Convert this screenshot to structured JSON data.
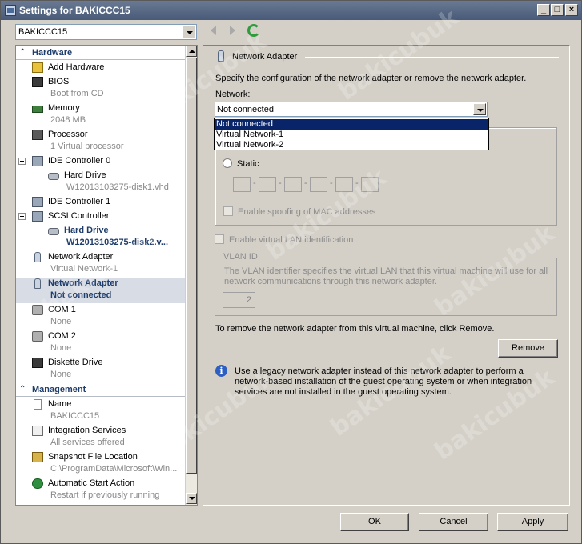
{
  "window": {
    "title": "Settings for BAKICCC15",
    "min_btn": "_",
    "max_btn": "□",
    "close_btn": "×"
  },
  "machine_selector": {
    "value": "BAKICCC15"
  },
  "tree": {
    "hardware_header": "Hardware",
    "management_header": "Management",
    "items": [
      {
        "label": "Add Hardware",
        "sub": "",
        "icon": "add-hardware-icon"
      },
      {
        "label": "BIOS",
        "sub": "Boot from CD",
        "icon": "bios-icon"
      },
      {
        "label": "Memory",
        "sub": "2048 MB",
        "icon": "memory-icon"
      },
      {
        "label": "Processor",
        "sub": "1 Virtual processor",
        "icon": "processor-icon"
      },
      {
        "label": "IDE Controller 0",
        "sub": "",
        "icon": "ide-controller-icon"
      },
      {
        "label": "Hard Drive",
        "sub": "W12013103275-disk1.vhd",
        "icon": "hard-drive-icon"
      },
      {
        "label": "IDE Controller 1",
        "sub": "",
        "icon": "ide-controller-icon"
      },
      {
        "label": "SCSI Controller",
        "sub": "",
        "icon": "scsi-controller-icon"
      },
      {
        "label": "Hard Drive",
        "sub": "W12013103275-disk2.v...",
        "icon": "hard-drive-icon"
      },
      {
        "label": "Network Adapter",
        "sub": "Virtual Network-1",
        "icon": "network-adapter-icon"
      },
      {
        "label": "Network Adapter",
        "sub": "Not connected",
        "icon": "network-adapter-icon"
      },
      {
        "label": "COM 1",
        "sub": "None",
        "icon": "com-port-icon"
      },
      {
        "label": "COM 2",
        "sub": "None",
        "icon": "com-port-icon"
      },
      {
        "label": "Diskette Drive",
        "sub": "None",
        "icon": "diskette-icon"
      },
      {
        "label": "Name",
        "sub": "BAKICCC15",
        "icon": "name-icon"
      },
      {
        "label": "Integration Services",
        "sub": "All services offered",
        "icon": "integration-services-icon"
      },
      {
        "label": "Snapshot File Location",
        "sub": "C:\\ProgramData\\Microsoft\\Win...",
        "icon": "snapshot-icon"
      },
      {
        "label": "Automatic Start Action",
        "sub": "Restart if previously running",
        "icon": "start-action-icon"
      }
    ]
  },
  "details": {
    "header": "Network Adapter",
    "description": "Specify the configuration of the network adapter or remove the network adapter.",
    "network_label": "Network:",
    "network_value": "Not connected",
    "network_options": [
      "Not connected",
      "Virtual Network-1",
      "Virtual Network-2"
    ],
    "static_label": "Static",
    "mac_spoof_label": "Enable spoofing of MAC addresses",
    "vlan_enable_label": "Enable virtual LAN identification",
    "vlan_group_label": "VLAN ID",
    "vlan_desc": "The VLAN identifier specifies the virtual LAN that this virtual machine will use for all network communications through this network adapter.",
    "vlan_value": "2",
    "remove_text": "To remove the network adapter from this virtual machine, click Remove.",
    "remove_button": "Remove",
    "legacy_info": "Use a legacy network adapter instead of this network adapter to perform a network-based installation of the guest operating system or when integration services are not installed in the guest operating system."
  },
  "footer": {
    "ok": "OK",
    "cancel": "Cancel",
    "apply": "Apply"
  },
  "watermark": "bakicubuk"
}
